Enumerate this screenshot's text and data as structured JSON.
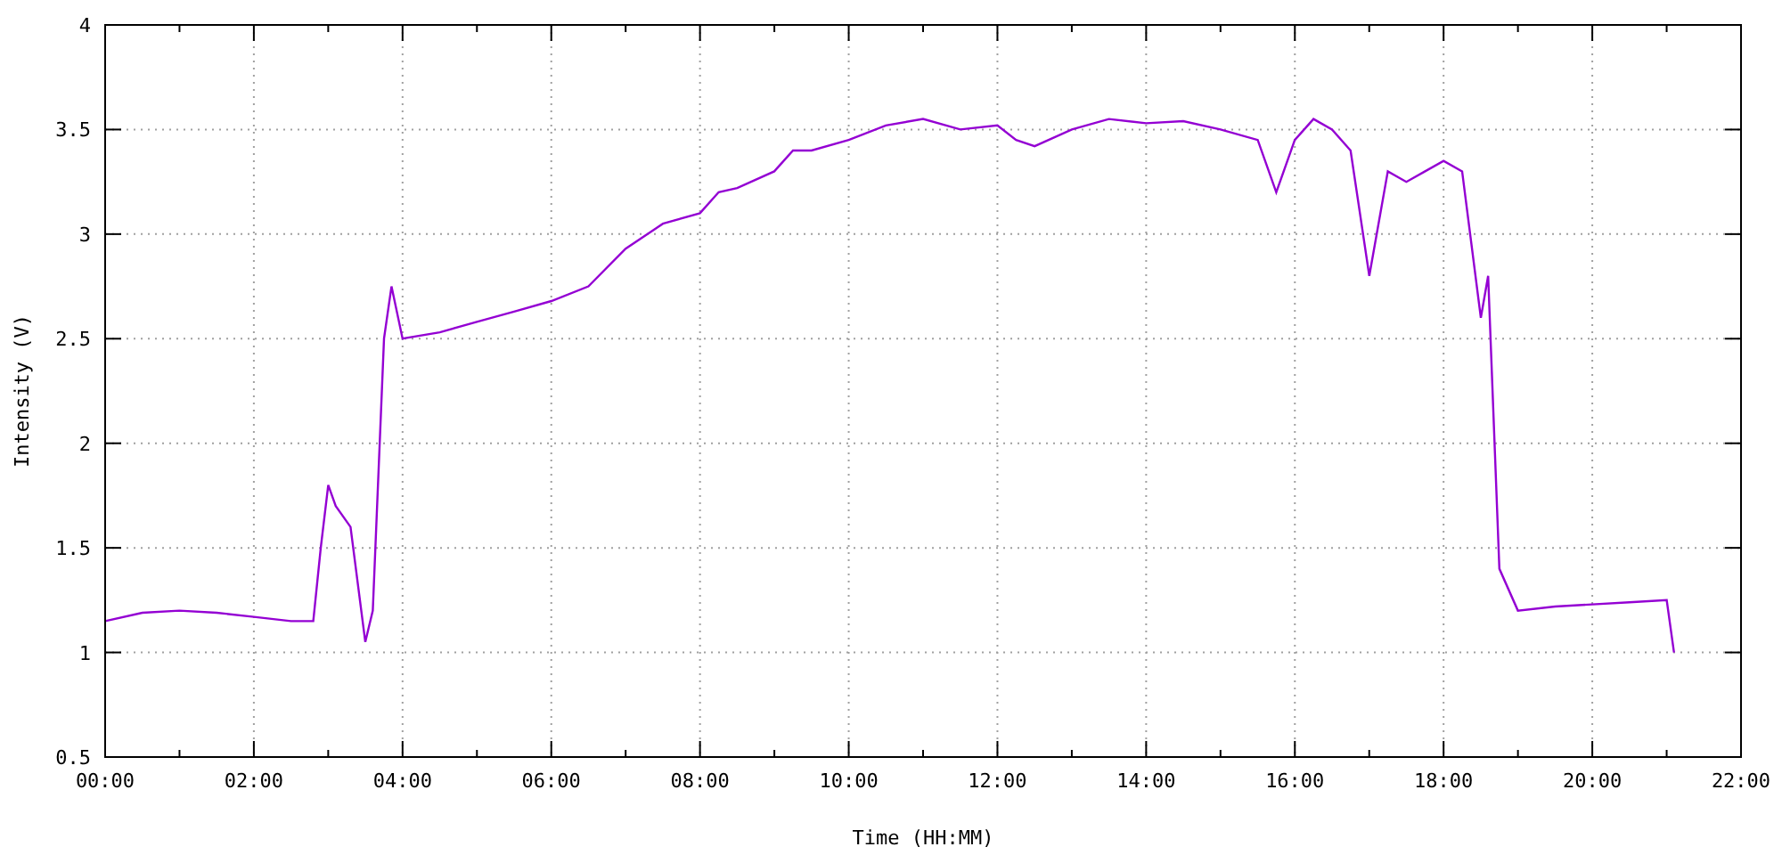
{
  "chart_data": {
    "type": "line",
    "xlabel": "Time (HH:MM)",
    "ylabel": "Intensity (V)",
    "x": [
      0,
      0.5,
      1,
      1.5,
      2,
      2.5,
      2.8,
      2.9,
      3.0,
      3.1,
      3.3,
      3.5,
      3.6,
      3.75,
      3.85,
      4.0,
      4.5,
      5,
      5.5,
      6,
      6.5,
      7,
      7.5,
      8,
      8.25,
      8.5,
      9,
      9.25,
      9.5,
      10,
      10.5,
      11,
      11.5,
      12,
      12.25,
      12.5,
      13,
      13.5,
      14,
      14.5,
      15,
      15.5,
      15.75,
      16,
      16.25,
      16.5,
      16.75,
      17,
      17.25,
      17.5,
      17.75,
      18,
      18.25,
      18.5,
      18.6,
      18.75,
      19,
      19.5,
      20,
      20.5,
      21,
      21.1
    ],
    "series": [
      {
        "color": "#9400d3",
        "values": [
          1.15,
          1.19,
          1.2,
          1.19,
          1.17,
          1.15,
          1.15,
          1.5,
          1.8,
          1.7,
          1.6,
          1.05,
          1.2,
          2.5,
          2.75,
          2.5,
          2.53,
          2.58,
          2.63,
          2.68,
          2.75,
          2.93,
          3.05,
          3.1,
          3.2,
          3.22,
          3.3,
          3.4,
          3.4,
          3.45,
          3.52,
          3.55,
          3.5,
          3.52,
          3.45,
          3.42,
          3.5,
          3.55,
          3.53,
          3.54,
          3.5,
          3.45,
          3.2,
          3.45,
          3.55,
          3.5,
          3.4,
          2.8,
          3.3,
          3.25,
          3.3,
          3.35,
          3.3,
          2.6,
          2.8,
          1.4,
          1.2,
          1.22,
          1.23,
          1.24,
          1.25,
          1.0
        ]
      }
    ],
    "xlim": [
      0,
      22
    ],
    "ylim": [
      0.5,
      4
    ],
    "xticks": [
      {
        "value": 0,
        "label": "00:00"
      },
      {
        "value": 2,
        "label": "02:00"
      },
      {
        "value": 4,
        "label": "04:00"
      },
      {
        "value": 6,
        "label": "06:00"
      },
      {
        "value": 8,
        "label": "08:00"
      },
      {
        "value": 10,
        "label": "10:00"
      },
      {
        "value": 12,
        "label": "12:00"
      },
      {
        "value": 14,
        "label": "14:00"
      },
      {
        "value": 16,
        "label": "16:00"
      },
      {
        "value": 18,
        "label": "18:00"
      },
      {
        "value": 20,
        "label": "20:00"
      },
      {
        "value": 22,
        "label": "22:00"
      }
    ],
    "yticks": [
      0.5,
      1,
      1.5,
      2,
      2.5,
      3,
      3.5,
      4
    ],
    "grid": true
  }
}
